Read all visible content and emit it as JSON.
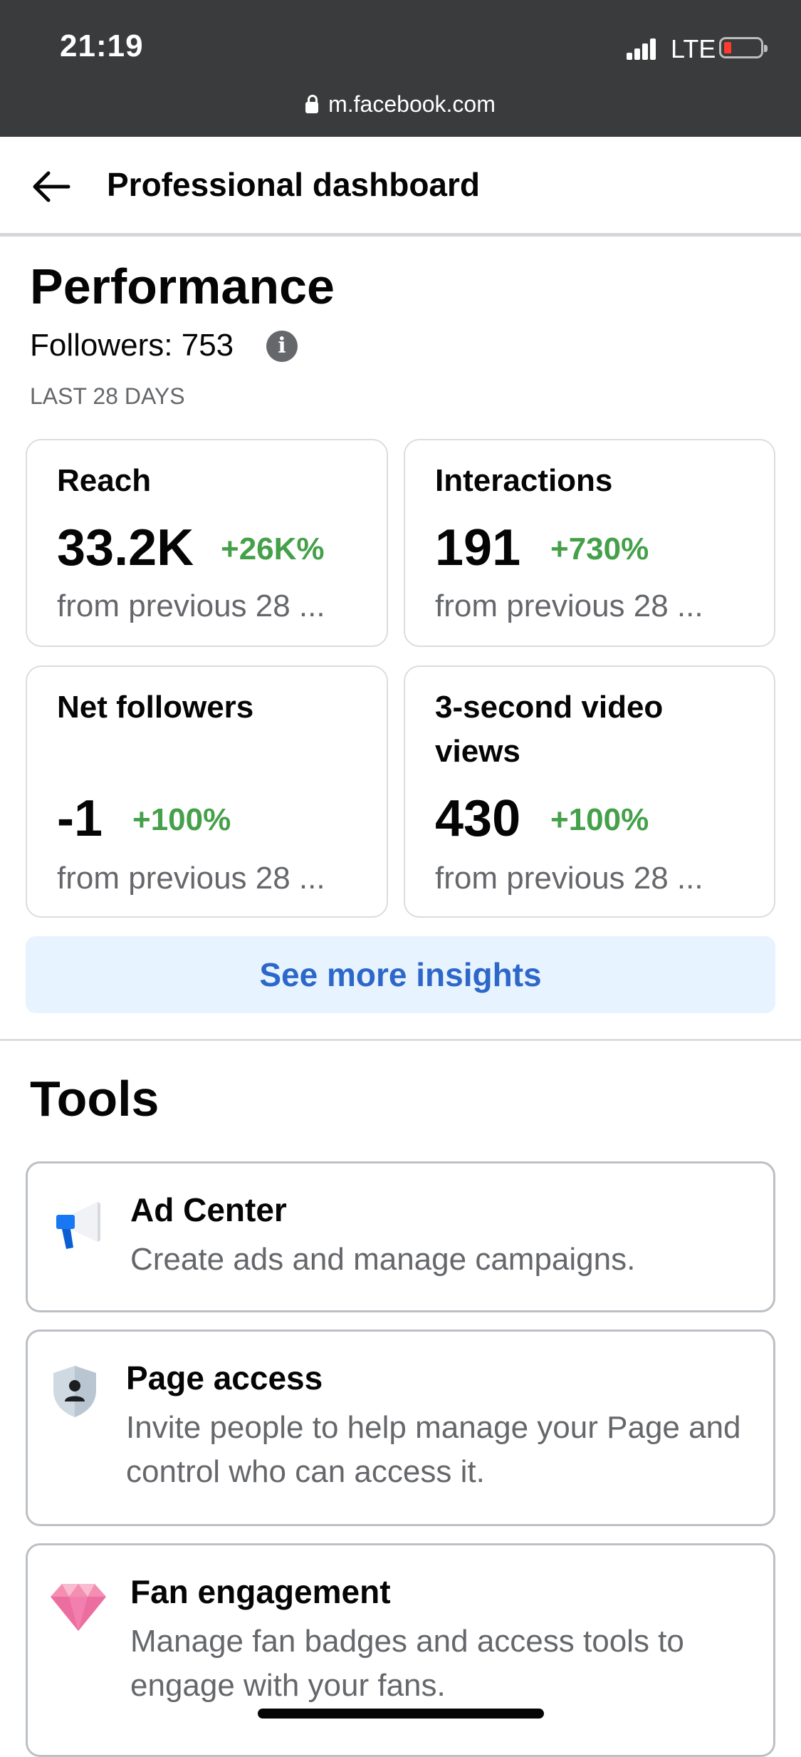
{
  "status_bar": {
    "time": "21:19",
    "network": "LTE",
    "battery_color": "#ff3b30",
    "url": "m.facebook.com"
  },
  "header": {
    "title": "Professional dashboard",
    "back_icon": "arrow-left-icon"
  },
  "performance": {
    "title": "Performance",
    "followers": "Followers: 753",
    "info_icon": "i",
    "period": "LAST 28 DAYS",
    "cards": [
      {
        "label": "Reach",
        "value": "33.2K",
        "change": "+26K%",
        "sub": "from previous 28 ..."
      },
      {
        "label": "Interactions",
        "value": "191",
        "change": "+730%",
        "sub": "from previous 28 ..."
      },
      {
        "label": "Net followers",
        "value": "-1",
        "change": "+100%",
        "sub": "from previous 28 ..."
      },
      {
        "label": "3-second video views",
        "value": "430",
        "change": "+100%",
        "sub": "from previous 28 ..."
      }
    ],
    "see_more": "See more insights",
    "positive_color": "#45a04a",
    "accent_color": "#2d67c9"
  },
  "tools": {
    "title": "Tools",
    "items": [
      {
        "name": "Ad Center",
        "desc": "Create ads and manage campaigns.",
        "icon": "megaphone-icon"
      },
      {
        "name": "Page access",
        "desc": "Invite people to help manage your Page and control who can access it.",
        "icon": "shield-person-icon"
      },
      {
        "name": "Fan engagement",
        "desc": "Manage fan badges and access tools to engage with your fans.",
        "icon": "diamond-icon"
      }
    ]
  }
}
